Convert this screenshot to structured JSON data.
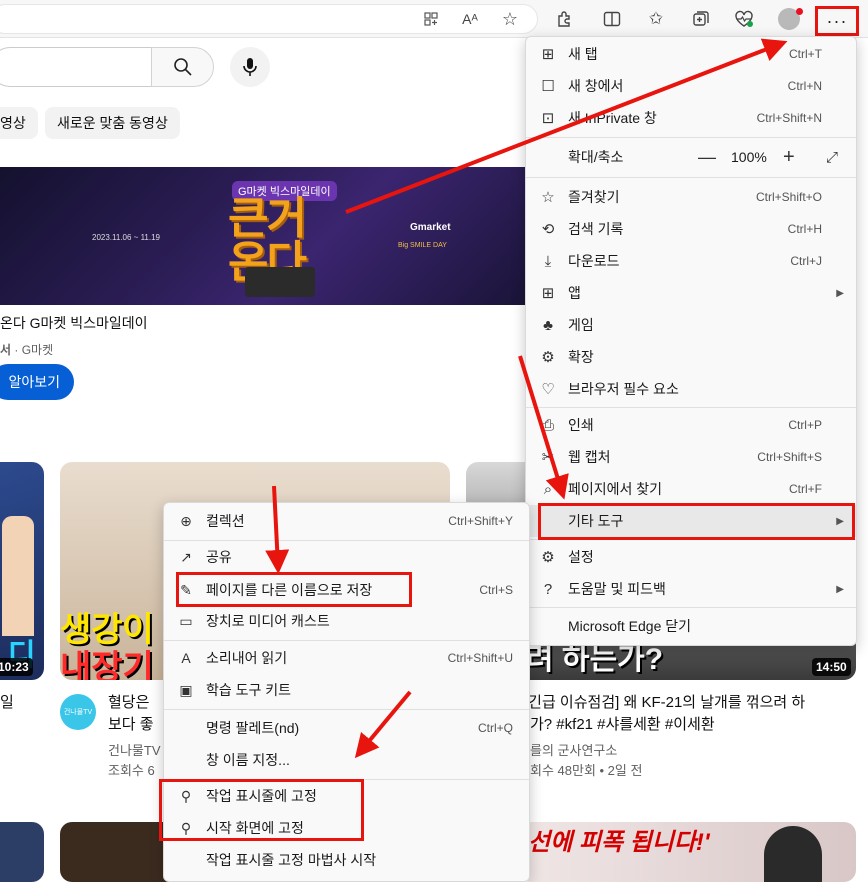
{
  "toolbar": {
    "icons": [
      "app-grid-icon",
      "read-aloud-icon",
      "favorite-star-icon",
      "extensions-icon",
      "split-screen-icon",
      "favorites-icon",
      "collections-icon",
      "browser-essentials-icon",
      "profile-icon",
      "more-icon"
    ],
    "more_label": "···",
    "read_aloud_glyph": "Aᴬ"
  },
  "youtube": {
    "chips": [
      "영상",
      "새로운 맞춤 동영상"
    ],
    "ad": {
      "banner_top": "G마켓 빅스마일데이",
      "banner_big_1": "큰거",
      "banner_big_2": "온다",
      "banner_date": "2023.11.06 ~ 11.19",
      "banner_brand": "Gmarket",
      "banner_sub": "Big SMILE DAY",
      "title": "온다 G마켓 빅스마일데이",
      "channel_bold": "서",
      "channel": "· G마켓",
      "learn_more": "알아보기"
    },
    "videos": [
      {
        "thumb_text": "디",
        "duration": "10:23",
        "title_1": "일",
        "title_2": "",
        "channel": "",
        "meta": ""
      },
      {
        "thumb_text_1": "생강이",
        "thumb_text_2": "내장기",
        "avatar_text": "건나물TV",
        "title_1": "혈당은",
        "title_2": "보다 좋",
        "channel": "건나물TV",
        "meta": "조회수 6"
      },
      {
        "thumb_text": "려 하는가?",
        "duration": "14:50",
        "title_1": "[긴급 이슈점검] 왜 KF-21의 날개를 꺾으려 하",
        "title_2": "가? #kf21 #샤를세환 #이세환",
        "channel": "를의 군사연구소",
        "meta": "회수 48만회 • 2일 전"
      },
      {
        "thumb_text": "선에 피폭 됩니다!'"
      }
    ]
  },
  "main_menu": {
    "items": [
      {
        "icon": "new-tab-icon",
        "glyph": "⊞",
        "label": "새 탭",
        "shortcut": "Ctrl+T"
      },
      {
        "icon": "new-window-icon",
        "glyph": "☐",
        "label": "새 창에서",
        "shortcut": "Ctrl+N"
      },
      {
        "icon": "inprivate-icon",
        "glyph": "⊡",
        "label": "새 InPrivate 창",
        "shortcut": "Ctrl+Shift+N"
      },
      {
        "icon": "zoom-icon",
        "glyph": "",
        "label": "확대/축소",
        "shortcut": ""
      },
      {
        "icon": "favorites-icon",
        "glyph": "☆",
        "label": "즐겨찾기",
        "shortcut": "Ctrl+Shift+O"
      },
      {
        "icon": "history-icon",
        "glyph": "⟲",
        "label": "검색 기록",
        "shortcut": "Ctrl+H"
      },
      {
        "icon": "download-icon",
        "glyph": "⤓",
        "label": "다운로드",
        "shortcut": "Ctrl+J"
      },
      {
        "icon": "apps-icon",
        "glyph": "⊞",
        "label": "앱",
        "shortcut": ""
      },
      {
        "icon": "games-icon",
        "glyph": "♣",
        "label": "게임",
        "shortcut": ""
      },
      {
        "icon": "extensions-icon",
        "glyph": "⚙",
        "label": "확장",
        "shortcut": ""
      },
      {
        "icon": "browser-essentials-icon",
        "glyph": "♡",
        "label": "브라우저 필수 요소",
        "shortcut": ""
      },
      {
        "icon": "print-icon",
        "glyph": "⎙",
        "label": "인쇄",
        "shortcut": "Ctrl+P"
      },
      {
        "icon": "web-capture-icon",
        "glyph": "✂",
        "label": "웹 캡처",
        "shortcut": "Ctrl+Shift+S"
      },
      {
        "icon": "find-on-page-icon",
        "glyph": "⌕",
        "label": "페이지에서 찾기",
        "shortcut": "Ctrl+F"
      },
      {
        "icon": "more-tools-icon",
        "glyph": "",
        "label": "기타 도구",
        "shortcut": ""
      },
      {
        "icon": "settings-icon",
        "glyph": "⚙",
        "label": "설정",
        "shortcut": ""
      },
      {
        "icon": "help-icon",
        "glyph": "?",
        "label": "도움말 및 피드백",
        "shortcut": ""
      },
      {
        "icon": "",
        "glyph": "",
        "label": "Microsoft Edge 닫기",
        "shortcut": ""
      }
    ],
    "zoom": {
      "minus": "—",
      "value": "100%",
      "plus": "+",
      "fullscreen": "⤢"
    }
  },
  "sub_menu": {
    "items": [
      {
        "icon": "collections-icon",
        "glyph": "⊕",
        "label": "컬렉션",
        "shortcut": "Ctrl+Shift+Y"
      },
      {
        "icon": "share-icon",
        "glyph": "↗",
        "label": "공유",
        "shortcut": ""
      },
      {
        "icon": "save-page-icon",
        "glyph": "✎",
        "label": "페이지를 다른 이름으로 저장",
        "shortcut": "Ctrl+S"
      },
      {
        "icon": "cast-icon",
        "glyph": "▭",
        "label": "장치로 미디어 캐스트",
        "shortcut": ""
      },
      {
        "icon": "read-aloud-icon",
        "glyph": "A",
        "label": "소리내어 읽기",
        "shortcut": "Ctrl+Shift+U"
      },
      {
        "icon": "learning-tools-icon",
        "glyph": "▣",
        "label": "학습 도구 키트",
        "shortcut": ""
      },
      {
        "icon": "",
        "glyph": "",
        "label": "명령 팔레트(nd)",
        "shortcut": "Ctrl+Q"
      },
      {
        "icon": "",
        "glyph": "",
        "label": "창 이름 지정...",
        "shortcut": ""
      },
      {
        "icon": "pin-icon",
        "glyph": "⚲",
        "label": "작업 표시줄에 고정",
        "shortcut": ""
      },
      {
        "icon": "pin-icon",
        "glyph": "⚲",
        "label": "시작 화면에 고정",
        "shortcut": ""
      },
      {
        "icon": "",
        "glyph": "",
        "label": "작업 표시줄 고정 마법사 시작",
        "shortcut": ""
      }
    ]
  },
  "annotation": {
    "color": "#e8150f"
  }
}
